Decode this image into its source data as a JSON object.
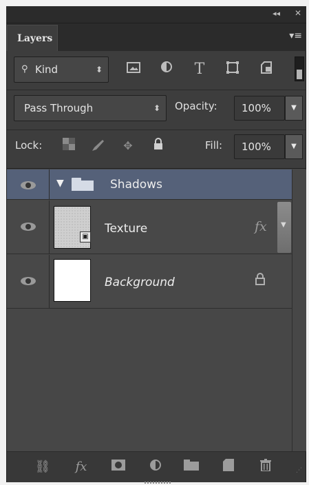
{
  "panel": {
    "tab_label": "Layers",
    "collapse_glyph": "◂◂",
    "close_glyph": "✕",
    "menu_glyph": "▾≡"
  },
  "filter": {
    "search_glyph": "⚲",
    "kind_label": "Kind",
    "icons": [
      "image-filter-icon",
      "adjustment-filter-icon",
      "type-filter-icon",
      "shape-filter-icon",
      "smart-object-filter-icon"
    ]
  },
  "blend": {
    "mode": "Pass Through",
    "opacity_label": "Opacity:",
    "opacity_value": "100%"
  },
  "lock": {
    "label": "Lock:",
    "fill_label": "Fill:",
    "fill_value": "100%"
  },
  "layers": [
    {
      "name": "Shadows",
      "type": "group",
      "selected": true
    },
    {
      "name": "Texture",
      "type": "smart-object",
      "fx_label": "fx"
    },
    {
      "name": "Background",
      "type": "background",
      "locked": true
    }
  ],
  "footer_icons": [
    "link-layers-icon",
    "layer-style-icon",
    "add-mask-icon",
    "adjustment-layer-icon",
    "new-group-icon",
    "new-layer-icon",
    "delete-layer-icon"
  ],
  "colors": {
    "panel_bg": "#3d3d3d",
    "selected_row": "#556179",
    "list_bg": "#474747"
  }
}
